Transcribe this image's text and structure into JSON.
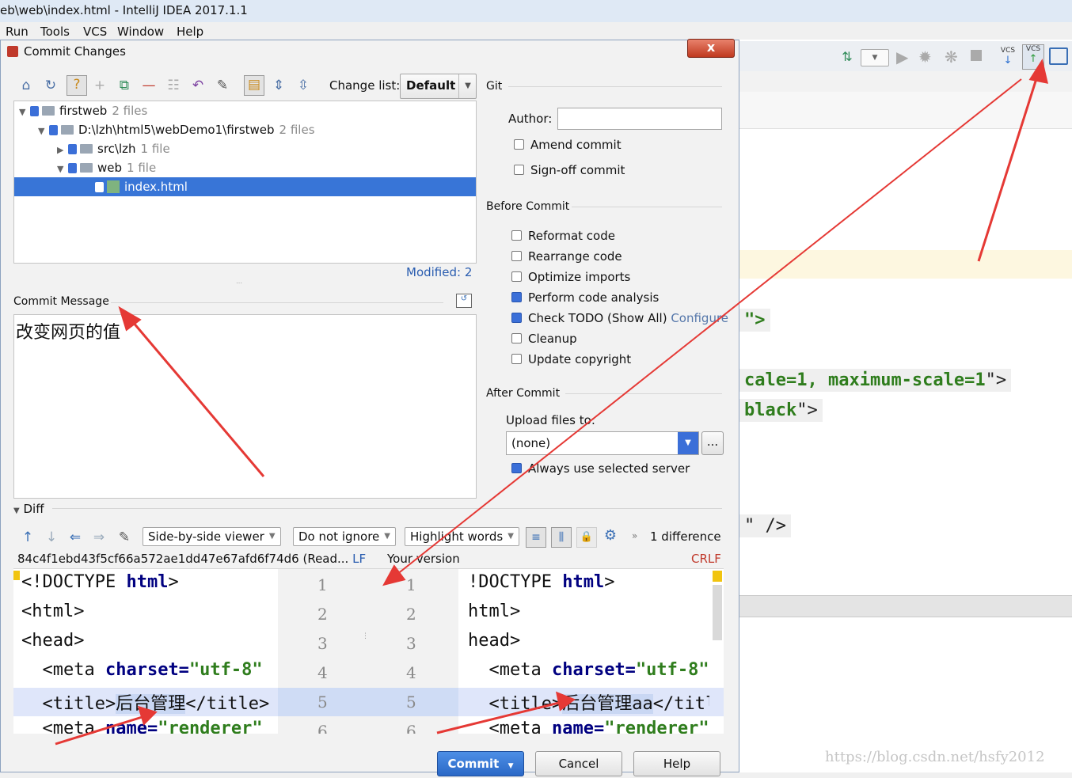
{
  "window": {
    "title": "eb\\web\\index.html - IntelliJ IDEA 2017.1.1"
  },
  "menu": [
    "Run",
    "Tools",
    "VCS",
    "Window",
    "Help"
  ],
  "dialog": {
    "title": "Commit Changes",
    "close": "x",
    "change_list_label": "Change list:",
    "change_list_value": "Default",
    "tree": [
      {
        "label": "firstweb",
        "count": "2 files"
      },
      {
        "label": "D:\\lzh\\html5\\webDemo1\\firstweb",
        "count": "2 files"
      },
      {
        "label": "src\\lzh",
        "count": "1 file"
      },
      {
        "label": "web",
        "count": "1 file"
      },
      {
        "label": "index.html",
        "count": ""
      }
    ],
    "modified": "Modified: 2",
    "commit_message_label": "Commit Message",
    "commit_message": "改变网页的值",
    "git": {
      "header": "Git",
      "author_label": "Author:",
      "author_value": "",
      "amend": "Amend commit",
      "signoff": "Sign-off commit"
    },
    "before_commit": {
      "header": "Before Commit",
      "items": [
        {
          "label": "Reformat code",
          "checked": false
        },
        {
          "label": "Rearrange code",
          "checked": false
        },
        {
          "label": "Optimize imports",
          "checked": false
        },
        {
          "label": "Perform code analysis",
          "checked": true
        },
        {
          "label": "Check TODO (Show All)",
          "checked": true
        },
        {
          "label": "Cleanup",
          "checked": false
        },
        {
          "label": "Update copyright",
          "checked": false
        }
      ],
      "configure": "Configure"
    },
    "after_commit": {
      "header": "After Commit",
      "upload_label": "Upload files to:",
      "upload_value": "(none)",
      "browse": "...",
      "always": "Always use selected server"
    },
    "diff": {
      "header": "Diff",
      "viewer": "Side-by-side viewer",
      "ignore": "Do not ignore",
      "highlight": "Highlight words",
      "difference": "1 difference",
      "left_title": "84c4f1ebd43f5cf66a572ae1dd47e67afd6f74d6 (Read...",
      "left_lf": "LF",
      "right_title": "Your version",
      "right_crlf": "CRLF",
      "left_lines": [
        {
          "a": "<!DOCTYPE ",
          "b": "html",
          "c": ">",
          "d": ""
        },
        {
          "a": "<html>",
          "b": "",
          "c": "",
          "d": ""
        },
        {
          "a": "<head>",
          "b": "",
          "c": "",
          "d": ""
        },
        {
          "a": "  <meta ",
          "b": "charset=",
          "c": "\"utf-8\"",
          "d": ""
        },
        {
          "a": "  <title>",
          "b": "后台管理",
          "c": "</title>",
          "d": ""
        },
        {
          "a": "  <meta ",
          "b": "name=",
          "c": "\"renderer\"",
          "d": ""
        }
      ],
      "right_lines": [
        {
          "a": "!DOCTYPE ",
          "b": "html",
          "c": ">",
          "d": ""
        },
        {
          "a": "html>",
          "b": "",
          "c": "",
          "d": ""
        },
        {
          "a": "head>",
          "b": "",
          "c": "",
          "d": ""
        },
        {
          "a": "  <meta ",
          "b": "charset=",
          "c": "\"utf-8\"",
          "d": ""
        },
        {
          "a": "  <title>",
          "b": "后台管理aa",
          "c": "</title>",
          "d": ""
        },
        {
          "a": "  <meta ",
          "b": "name=",
          "c": "\"renderer\"",
          "d": ""
        }
      ],
      "line_numbers": [
        "1",
        "2",
        "3",
        "4",
        "5",
        "6"
      ]
    },
    "buttons": {
      "commit": "Commit",
      "cancel": "Cancel",
      "help": "Help"
    }
  },
  "ide": {
    "vcs1": "VCS",
    "vcs2": "VCS",
    "frag1": "\">",
    "frag2a": "cale=1, ",
    "frag2b": "maximum-scale=1",
    "frag2c": "\">",
    "frag3a": "black",
    "frag3b": "\">",
    "frag4": "\" />"
  },
  "watermark": "https://blog.csdn.net/hsfy2012",
  "colors": {
    "accent": "#3875d7",
    "arrow": "#e53935"
  }
}
